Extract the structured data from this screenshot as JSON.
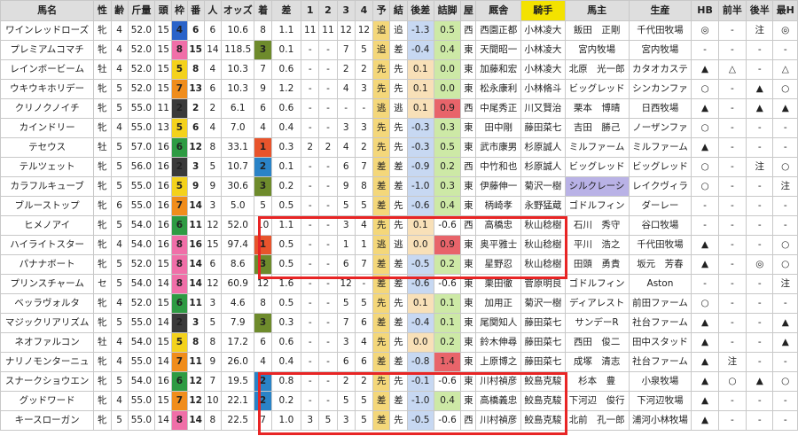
{
  "headers": [
    "馬名",
    "性",
    "齢",
    "斤量",
    "頭",
    "枠",
    "番",
    "人",
    "オッズ",
    "着",
    "差",
    "1",
    "2",
    "3",
    "4",
    "予",
    "結",
    "後差",
    "詰脚",
    "屋",
    "厩舎",
    "騎手",
    "馬主",
    "生産",
    "HB",
    "前半",
    "後半",
    "最H"
  ],
  "rows": [
    {
      "name": "ワインレッドローズ",
      "sex": "牝",
      "age": "4",
      "kin": "52.0",
      "tou": "15",
      "waku": "4",
      "ban": "6",
      "nin": "6",
      "odds": "10.6",
      "chaku": "8",
      "sa": "1.1",
      "c1": "11",
      "c2": "11",
      "c3": "12",
      "c4": "12",
      "yoso": "追",
      "kekka": "追",
      "kosa": "-1.3",
      "tsume": "0.5",
      "ya": "西",
      "trainer": "西園正都",
      "jockey": "小林凌大",
      "owner": "飯田　正剛",
      "breeder": "千代田牧場",
      "hb": "◎",
      "zen": "-",
      "kou": "注",
      "saih": "◎"
    },
    {
      "name": "プレミアムコマチ",
      "sex": "牝",
      "age": "4",
      "kin": "52.0",
      "tou": "15",
      "waku": "8",
      "ban": "15",
      "nin": "14",
      "odds": "118.5",
      "chaku": "3",
      "sa": "0.1",
      "c1": "-",
      "c2": "-",
      "c3": "7",
      "c4": "5",
      "yoso": "追",
      "kekka": "差",
      "kosa": "-0.4",
      "tsume": "0.4",
      "ya": "東",
      "trainer": "天間昭一",
      "jockey": "小林凌大",
      "owner": "宮内牧場",
      "breeder": "宮内牧場",
      "hb": "-",
      "zen": "-",
      "kou": "-",
      "saih": "-"
    },
    {
      "name": "レインボービーム",
      "sex": "牡",
      "age": "4",
      "kin": "52.0",
      "tou": "15",
      "waku": "5",
      "ban": "8",
      "nin": "4",
      "odds": "10.3",
      "chaku": "7",
      "sa": "0.6",
      "c1": "-",
      "c2": "-",
      "c3": "2",
      "c4": "2",
      "yoso": "先",
      "kekka": "先",
      "kosa": "0.1",
      "tsume": "0.0",
      "ya": "東",
      "trainer": "加藤和宏",
      "jockey": "小林凌大",
      "owner": "北原　光一郎",
      "breeder": "カタオカステ",
      "hb": "▲",
      "zen": "△",
      "kou": "-",
      "saih": "△"
    },
    {
      "name": "ウキウキホリデー",
      "sex": "牝",
      "age": "5",
      "kin": "52.0",
      "tou": "15",
      "waku": "7",
      "ban": "13",
      "nin": "6",
      "odds": "10.3",
      "chaku": "9",
      "sa": "1.2",
      "c1": "-",
      "c2": "-",
      "c3": "4",
      "c4": "3",
      "yoso": "先",
      "kekka": "先",
      "kosa": "0.1",
      "tsume": "0.0",
      "ya": "東",
      "trainer": "松永康利",
      "jockey": "小林脩斗",
      "owner": "ビッグレッド",
      "breeder": "シンカンファ",
      "hb": "○",
      "zen": "-",
      "kou": "▲",
      "saih": "○"
    },
    {
      "name": "クリノクノイチ",
      "sex": "牝",
      "age": "5",
      "kin": "55.0",
      "tou": "11",
      "waku": "2",
      "ban": "2",
      "nin": "2",
      "odds": "6.1",
      "chaku": "6",
      "sa": "0.6",
      "c1": "-",
      "c2": "-",
      "c3": "-",
      "c4": "-",
      "yoso": "逃",
      "kekka": "逃",
      "kosa": "0.1",
      "tsume": "0.9",
      "ya": "西",
      "trainer": "中尾秀正",
      "jockey": "川又賢治",
      "owner": "栗本　博晴",
      "breeder": "日西牧場",
      "hb": "▲",
      "zen": "-",
      "kou": "▲",
      "saih": "▲"
    },
    {
      "name": "カインドリー",
      "sex": "牝",
      "age": "4",
      "kin": "55.0",
      "tou": "13",
      "waku": "5",
      "ban": "6",
      "nin": "4",
      "odds": "7.0",
      "chaku": "4",
      "sa": "0.4",
      "c1": "-",
      "c2": "-",
      "c3": "3",
      "c4": "3",
      "yoso": "先",
      "kekka": "先",
      "kosa": "-0.3",
      "tsume": "0.3",
      "ya": "東",
      "trainer": "田中剛",
      "jockey": "藤田菜七",
      "owner": "吉田　勝己",
      "breeder": "ノーザンファ",
      "hb": "○",
      "zen": "-",
      "kou": "-",
      "saih": "-"
    },
    {
      "name": "テセウス",
      "sex": "牡",
      "age": "5",
      "kin": "57.0",
      "tou": "16",
      "waku": "6",
      "ban": "12",
      "nin": "8",
      "odds": "33.1",
      "chaku": "1",
      "sa": "0.3",
      "c1": "2",
      "c2": "2",
      "c3": "4",
      "c4": "2",
      "yoso": "先",
      "kekka": "先",
      "kosa": "-0.3",
      "tsume": "0.5",
      "ya": "東",
      "trainer": "武市康男",
      "jockey": "杉原誠人",
      "owner": "ミルファーム",
      "breeder": "ミルファーム",
      "hb": "▲",
      "zen": "-",
      "kou": "-",
      "saih": "-"
    },
    {
      "name": "テルツェット",
      "sex": "牝",
      "age": "5",
      "kin": "56.0",
      "tou": "16",
      "waku": "2",
      "ban": "3",
      "nin": "5",
      "odds": "10.7",
      "chaku": "2",
      "sa": "0.1",
      "c1": "-",
      "c2": "-",
      "c3": "6",
      "c4": "7",
      "yoso": "差",
      "kekka": "差",
      "kosa": "-0.9",
      "tsume": "0.2",
      "ya": "西",
      "trainer": "中竹和也",
      "jockey": "杉原誠人",
      "owner": "ビッグレッド",
      "breeder": "ビッグレッド",
      "hb": "○",
      "zen": "-",
      "kou": "注",
      "saih": "○"
    },
    {
      "name": "カラフルキューブ",
      "sex": "牝",
      "age": "5",
      "kin": "55.0",
      "tou": "16",
      "waku": "5",
      "ban": "9",
      "nin": "9",
      "odds": "30.6",
      "chaku": "3",
      "sa": "0.2",
      "c1": "-",
      "c2": "-",
      "c3": "9",
      "c4": "8",
      "yoso": "差",
      "kekka": "差",
      "kosa": "-1.0",
      "tsume": "0.3",
      "ya": "東",
      "trainer": "伊藤伸一",
      "jockey": "菊沢一樹",
      "owner": "シルクレーシ",
      "breeder": "レイクヴィラ",
      "hb": "○",
      "zen": "-",
      "kou": "-",
      "saih": "注"
    },
    {
      "name": "ブルーストップ",
      "sex": "牝",
      "age": "6",
      "kin": "55.0",
      "tou": "16",
      "waku": "7",
      "ban": "14",
      "nin": "3",
      "odds": "5.0",
      "chaku": "5",
      "sa": "0.5",
      "c1": "-",
      "c2": "-",
      "c3": "5",
      "c4": "5",
      "yoso": "差",
      "kekka": "先",
      "kosa": "-0.6",
      "tsume": "0.4",
      "ya": "東",
      "trainer": "柄崎孝",
      "jockey": "永野猛蔵",
      "owner": "ゴドルフィン",
      "breeder": "ダーレー",
      "hb": "-",
      "zen": "-",
      "kou": "-",
      "saih": "-"
    },
    {
      "name": "ヒメノアイ",
      "sex": "牝",
      "age": "5",
      "kin": "54.0",
      "tou": "16",
      "waku": "6",
      "ban": "11",
      "nin": "12",
      "odds": "52.0",
      "chaku": "10",
      "sa": "1.1",
      "c1": "-",
      "c2": "-",
      "c3": "3",
      "c4": "4",
      "yoso": "先",
      "kekka": "先",
      "kosa": "0.1",
      "tsume": "-0.6",
      "ya": "西",
      "trainer": "高橋忠",
      "jockey": "秋山稔樹",
      "owner": "石川　秀守",
      "breeder": "谷口牧場",
      "hb": "-",
      "zen": "-",
      "kou": "-",
      "saih": "-"
    },
    {
      "name": "ハイライトスター",
      "sex": "牝",
      "age": "4",
      "kin": "54.0",
      "tou": "16",
      "waku": "8",
      "ban": "16",
      "nin": "15",
      "odds": "97.4",
      "chaku": "1",
      "sa": "0.5",
      "c1": "-",
      "c2": "-",
      "c3": "1",
      "c4": "1",
      "yoso": "逃",
      "kekka": "逃",
      "kosa": "0.0",
      "tsume": "0.9",
      "ya": "東",
      "trainer": "奥平雅士",
      "jockey": "秋山稔樹",
      "owner": "平川　浩之",
      "breeder": "千代田牧場",
      "hb": "▲",
      "zen": "-",
      "kou": "-",
      "saih": "○"
    },
    {
      "name": "パナナボート",
      "sex": "牝",
      "age": "5",
      "kin": "52.0",
      "tou": "15",
      "waku": "8",
      "ban": "14",
      "nin": "6",
      "odds": "8.6",
      "chaku": "3",
      "sa": "0.5",
      "c1": "-",
      "c2": "-",
      "c3": "6",
      "c4": "7",
      "yoso": "差",
      "kekka": "差",
      "kosa": "-0.5",
      "tsume": "0.2",
      "ya": "東",
      "trainer": "星野忍",
      "jockey": "秋山稔樹",
      "owner": "田頭　勇貴",
      "breeder": "坂元　芳春",
      "hb": "▲",
      "zen": "-",
      "kou": "◎",
      "saih": "○"
    },
    {
      "name": "プリンスチャーム",
      "sex": "セ",
      "age": "5",
      "kin": "54.0",
      "tou": "14",
      "waku": "8",
      "ban": "14",
      "nin": "12",
      "odds": "60.9",
      "chaku": "12",
      "sa": "1.6",
      "c1": "-",
      "c2": "-",
      "c3": "12",
      "c4": "-",
      "yoso": "差",
      "kekka": "差",
      "kosa": "-0.6",
      "tsume": "-0.6",
      "ya": "東",
      "trainer": "栗田徹",
      "jockey": "菅原明良",
      "owner": "ゴドルフィン",
      "breeder": "Aston",
      "hb": "-",
      "zen": "-",
      "kou": "-",
      "saih": "注"
    },
    {
      "name": "ベッラヴォルタ",
      "sex": "牝",
      "age": "4",
      "kin": "52.0",
      "tou": "15",
      "waku": "6",
      "ban": "11",
      "nin": "3",
      "odds": "4.6",
      "chaku": "8",
      "sa": "0.5",
      "c1": "-",
      "c2": "-",
      "c3": "5",
      "c4": "5",
      "yoso": "先",
      "kekka": "先",
      "kosa": "0.1",
      "tsume": "0.1",
      "ya": "東",
      "trainer": "加用正",
      "jockey": "菊沢一樹",
      "owner": "ディアレスト",
      "breeder": "前田ファーム",
      "hb": "○",
      "zen": "-",
      "kou": "-",
      "saih": "-"
    },
    {
      "name": "マジックリアリズム",
      "sex": "牝",
      "age": "5",
      "kin": "55.0",
      "tou": "14",
      "waku": "2",
      "ban": "3",
      "nin": "5",
      "odds": "7.9",
      "chaku": "3",
      "sa": "0.3",
      "c1": "-",
      "c2": "-",
      "c3": "7",
      "c4": "6",
      "yoso": "差",
      "kekka": "差",
      "kosa": "-0.4",
      "tsume": "0.1",
      "ya": "東",
      "trainer": "尾関知人",
      "jockey": "藤田菜七",
      "owner": "サンデーR",
      "breeder": "社台ファーム",
      "hb": "▲",
      "zen": "-",
      "kou": "-",
      "saih": "▲"
    },
    {
      "name": "ネオファルコン",
      "sex": "牡",
      "age": "4",
      "kin": "54.0",
      "tou": "15",
      "waku": "5",
      "ban": "8",
      "nin": "8",
      "odds": "17.2",
      "chaku": "6",
      "sa": "0.6",
      "c1": "-",
      "c2": "-",
      "c3": "3",
      "c4": "4",
      "yoso": "先",
      "kekka": "先",
      "kosa": "0.0",
      "tsume": "0.2",
      "ya": "東",
      "trainer": "鈴木伸尋",
      "jockey": "藤田菜七",
      "owner": "西田　俊二",
      "breeder": "田中スタッド",
      "hb": "▲",
      "zen": "-",
      "kou": "-",
      "saih": "▲"
    },
    {
      "name": "ナリノモンターニュ",
      "sex": "牝",
      "age": "4",
      "kin": "55.0",
      "tou": "14",
      "waku": "7",
      "ban": "11",
      "nin": "9",
      "odds": "26.0",
      "chaku": "4",
      "sa": "0.4",
      "c1": "-",
      "c2": "-",
      "c3": "6",
      "c4": "6",
      "yoso": "差",
      "kekka": "差",
      "kosa": "-0.8",
      "tsume": "1.4",
      "ya": "東",
      "trainer": "上原博之",
      "jockey": "藤田菜七",
      "owner": "成塚　清志",
      "breeder": "社台ファーム",
      "hb": "▲",
      "zen": "注",
      "kou": "-",
      "saih": "-"
    },
    {
      "name": "スナークショウエン",
      "sex": "牝",
      "age": "5",
      "kin": "54.0",
      "tou": "16",
      "waku": "6",
      "ban": "12",
      "nin": "7",
      "odds": "19.5",
      "chaku": "2",
      "sa": "0.8",
      "c1": "-",
      "c2": "-",
      "c3": "2",
      "c4": "2",
      "yoso": "先",
      "kekka": "先",
      "kosa": "-0.1",
      "tsume": "-0.6",
      "ya": "東",
      "trainer": "川村禎彦",
      "jockey": "鮫島克駿",
      "owner": "杉本　豊",
      "breeder": "小泉牧場",
      "hb": "▲",
      "zen": "○",
      "kou": "▲",
      "saih": "○"
    },
    {
      "name": "グッドワード",
      "sex": "牝",
      "age": "4",
      "kin": "55.0",
      "tou": "15",
      "waku": "7",
      "ban": "12",
      "nin": "10",
      "odds": "22.1",
      "chaku": "2",
      "sa": "0.2",
      "c1": "-",
      "c2": "-",
      "c3": "5",
      "c4": "5",
      "yoso": "差",
      "kekka": "差",
      "kosa": "-1.0",
      "tsume": "0.4",
      "ya": "東",
      "trainer": "高橋義忠",
      "jockey": "鮫島克駿",
      "owner": "下河辺　俊行",
      "breeder": "下河辺牧場",
      "hb": "▲",
      "zen": "-",
      "kou": "-",
      "saih": "-"
    },
    {
      "name": "キースローガン",
      "sex": "牝",
      "age": "5",
      "kin": "55.0",
      "tou": "14",
      "waku": "8",
      "ban": "14",
      "nin": "8",
      "odds": "22.5",
      "chaku": "7",
      "sa": "1.0",
      "c1": "3",
      "c2": "5",
      "c3": "3",
      "c4": "5",
      "yoso": "差",
      "kekka": "先",
      "kosa": "-0.5",
      "tsume": "-0.6",
      "ya": "西",
      "trainer": "川村禎彦",
      "jockey": "鮫島克駿",
      "owner": "北前　孔一郎",
      "breeder": "浦河小林牧場",
      "hb": "▲",
      "zen": "-",
      "kou": "-",
      "saih": "-"
    }
  ],
  "colors": {
    "header_bg": "#dedede",
    "header_highlight": "#f3e200",
    "frame_highlight": "#e82525",
    "owner_highlight": "#b9b2e6"
  }
}
